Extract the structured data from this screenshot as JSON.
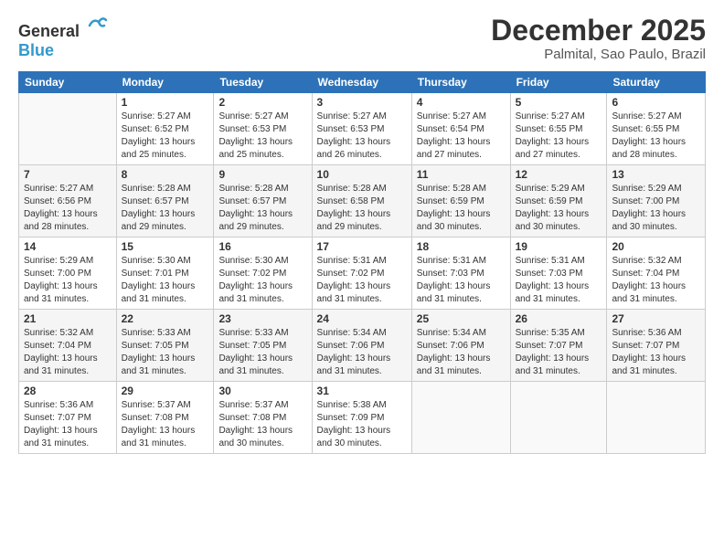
{
  "logo": {
    "general": "General",
    "blue": "Blue"
  },
  "header": {
    "month": "December 2025",
    "location": "Palmital, Sao Paulo, Brazil"
  },
  "weekdays": [
    "Sunday",
    "Monday",
    "Tuesday",
    "Wednesday",
    "Thursday",
    "Friday",
    "Saturday"
  ],
  "weeks": [
    [
      {
        "day": "",
        "info": ""
      },
      {
        "day": "1",
        "info": "Sunrise: 5:27 AM\nSunset: 6:52 PM\nDaylight: 13 hours\nand 25 minutes."
      },
      {
        "day": "2",
        "info": "Sunrise: 5:27 AM\nSunset: 6:53 PM\nDaylight: 13 hours\nand 25 minutes."
      },
      {
        "day": "3",
        "info": "Sunrise: 5:27 AM\nSunset: 6:53 PM\nDaylight: 13 hours\nand 26 minutes."
      },
      {
        "day": "4",
        "info": "Sunrise: 5:27 AM\nSunset: 6:54 PM\nDaylight: 13 hours\nand 27 minutes."
      },
      {
        "day": "5",
        "info": "Sunrise: 5:27 AM\nSunset: 6:55 PM\nDaylight: 13 hours\nand 27 minutes."
      },
      {
        "day": "6",
        "info": "Sunrise: 5:27 AM\nSunset: 6:55 PM\nDaylight: 13 hours\nand 28 minutes."
      }
    ],
    [
      {
        "day": "7",
        "info": "Sunrise: 5:27 AM\nSunset: 6:56 PM\nDaylight: 13 hours\nand 28 minutes."
      },
      {
        "day": "8",
        "info": "Sunrise: 5:28 AM\nSunset: 6:57 PM\nDaylight: 13 hours\nand 29 minutes."
      },
      {
        "day": "9",
        "info": "Sunrise: 5:28 AM\nSunset: 6:57 PM\nDaylight: 13 hours\nand 29 minutes."
      },
      {
        "day": "10",
        "info": "Sunrise: 5:28 AM\nSunset: 6:58 PM\nDaylight: 13 hours\nand 29 minutes."
      },
      {
        "day": "11",
        "info": "Sunrise: 5:28 AM\nSunset: 6:59 PM\nDaylight: 13 hours\nand 30 minutes."
      },
      {
        "day": "12",
        "info": "Sunrise: 5:29 AM\nSunset: 6:59 PM\nDaylight: 13 hours\nand 30 minutes."
      },
      {
        "day": "13",
        "info": "Sunrise: 5:29 AM\nSunset: 7:00 PM\nDaylight: 13 hours\nand 30 minutes."
      }
    ],
    [
      {
        "day": "14",
        "info": "Sunrise: 5:29 AM\nSunset: 7:00 PM\nDaylight: 13 hours\nand 31 minutes."
      },
      {
        "day": "15",
        "info": "Sunrise: 5:30 AM\nSunset: 7:01 PM\nDaylight: 13 hours\nand 31 minutes."
      },
      {
        "day": "16",
        "info": "Sunrise: 5:30 AM\nSunset: 7:02 PM\nDaylight: 13 hours\nand 31 minutes."
      },
      {
        "day": "17",
        "info": "Sunrise: 5:31 AM\nSunset: 7:02 PM\nDaylight: 13 hours\nand 31 minutes."
      },
      {
        "day": "18",
        "info": "Sunrise: 5:31 AM\nSunset: 7:03 PM\nDaylight: 13 hours\nand 31 minutes."
      },
      {
        "day": "19",
        "info": "Sunrise: 5:31 AM\nSunset: 7:03 PM\nDaylight: 13 hours\nand 31 minutes."
      },
      {
        "day": "20",
        "info": "Sunrise: 5:32 AM\nSunset: 7:04 PM\nDaylight: 13 hours\nand 31 minutes."
      }
    ],
    [
      {
        "day": "21",
        "info": "Sunrise: 5:32 AM\nSunset: 7:04 PM\nDaylight: 13 hours\nand 31 minutes."
      },
      {
        "day": "22",
        "info": "Sunrise: 5:33 AM\nSunset: 7:05 PM\nDaylight: 13 hours\nand 31 minutes."
      },
      {
        "day": "23",
        "info": "Sunrise: 5:33 AM\nSunset: 7:05 PM\nDaylight: 13 hours\nand 31 minutes."
      },
      {
        "day": "24",
        "info": "Sunrise: 5:34 AM\nSunset: 7:06 PM\nDaylight: 13 hours\nand 31 minutes."
      },
      {
        "day": "25",
        "info": "Sunrise: 5:34 AM\nSunset: 7:06 PM\nDaylight: 13 hours\nand 31 minutes."
      },
      {
        "day": "26",
        "info": "Sunrise: 5:35 AM\nSunset: 7:07 PM\nDaylight: 13 hours\nand 31 minutes."
      },
      {
        "day": "27",
        "info": "Sunrise: 5:36 AM\nSunset: 7:07 PM\nDaylight: 13 hours\nand 31 minutes."
      }
    ],
    [
      {
        "day": "28",
        "info": "Sunrise: 5:36 AM\nSunset: 7:07 PM\nDaylight: 13 hours\nand 31 minutes."
      },
      {
        "day": "29",
        "info": "Sunrise: 5:37 AM\nSunset: 7:08 PM\nDaylight: 13 hours\nand 31 minutes."
      },
      {
        "day": "30",
        "info": "Sunrise: 5:37 AM\nSunset: 7:08 PM\nDaylight: 13 hours\nand 30 minutes."
      },
      {
        "day": "31",
        "info": "Sunrise: 5:38 AM\nSunset: 7:09 PM\nDaylight: 13 hours\nand 30 minutes."
      },
      {
        "day": "",
        "info": ""
      },
      {
        "day": "",
        "info": ""
      },
      {
        "day": "",
        "info": ""
      }
    ]
  ]
}
